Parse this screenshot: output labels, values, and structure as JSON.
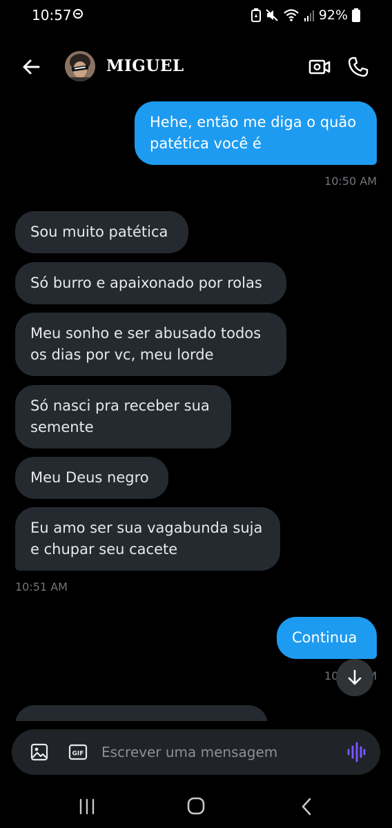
{
  "status_bar": {
    "time": "10:57",
    "battery": "92%"
  },
  "header": {
    "contact_name": "MIGUEL",
    "back_icon": "arrow-left-icon",
    "video_icon": "video-camera-icon",
    "call_icon": "phone-icon"
  },
  "messages": [
    {
      "direction": "sent",
      "text": "Hehe, então me diga o quão patética você é"
    },
    {
      "timestamp": "10:50 AM"
    },
    {
      "direction": "received",
      "text": "Sou muito patética"
    },
    {
      "direction": "received",
      "text": "Só burro e apaixonado por rolas"
    },
    {
      "direction": "received",
      "text": "Meu sonho e ser abusado todos os dias por vc, meu lorde"
    },
    {
      "direction": "received",
      "text": "Só nasci pra receber sua semente"
    },
    {
      "direction": "received",
      "text": "Meu Deus negro"
    },
    {
      "direction": "received",
      "text": "Eu amo ser sua vagabunda suja e chupar seu cacete"
    },
    {
      "timestamp": "10:51 AM"
    },
    {
      "direction": "sent",
      "text": "Continua"
    },
    {
      "timestamp": "10:51 AM"
    }
  ],
  "composer": {
    "placeholder": "Escrever uma mensagem",
    "gif_label": "GIF",
    "voice_color": "#7856ff"
  },
  "colors": {
    "background": "#000000",
    "sent_bubble": "#1d9bf0",
    "received_bubble": "#242a30",
    "timestamp": "#71767b"
  }
}
